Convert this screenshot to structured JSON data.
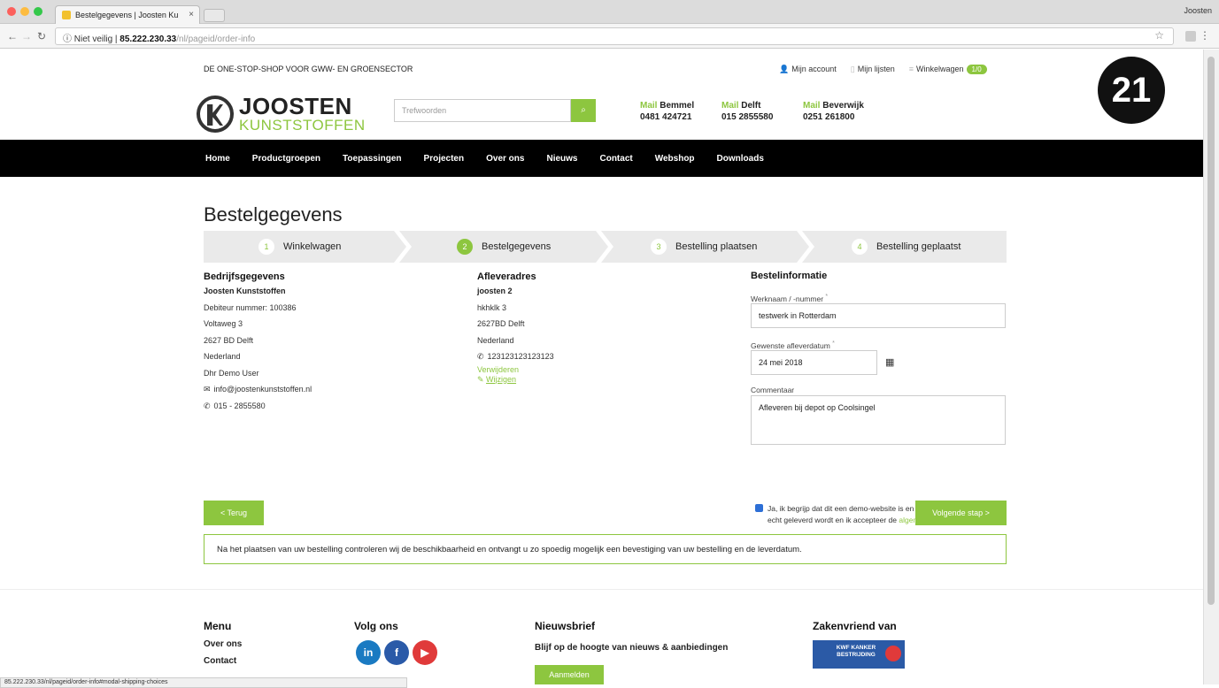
{
  "browser": {
    "tab_title": "Bestelgegevens | Joosten Ku",
    "tab_close": "×",
    "profile": "Joosten",
    "security": "Niet veilig",
    "host": "85.222.230.33",
    "path": "/nl/pageid/order-info",
    "status_url": "85.222.230.33/nl/pageid/order-info#modal-shipping-choices"
  },
  "header": {
    "tagline": "DE ONE-STOP-SHOP VOOR GWW- EN GROENSECTOR",
    "account": "Mijn account",
    "lists": "Mijn lijsten",
    "cart": "Winkelwagen",
    "cart_count": "1/0",
    "logo_main": "JOOSTEN",
    "logo_sub": "KUNSTSTOFFEN",
    "search_placeholder": "Trefwoorden",
    "contacts": [
      {
        "mail": "Mail",
        "city": "Bemmel",
        "phone": "0481 424721"
      },
      {
        "mail": "Mail",
        "city": "Delft",
        "phone": "015 2855580"
      },
      {
        "mail": "Mail",
        "city": "Beverwijk",
        "phone": "0251 261800"
      }
    ],
    "badge": "21"
  },
  "nav": [
    "Home",
    "Productgroepen",
    "Toepassingen",
    "Projecten",
    "Over ons",
    "Nieuws",
    "Contact",
    "Webshop",
    "Downloads"
  ],
  "page_title": "Bestelgegevens",
  "steps": [
    {
      "num": "1",
      "label": "Winkelwagen"
    },
    {
      "num": "2",
      "label": "Bestelgegevens"
    },
    {
      "num": "3",
      "label": "Bestelling plaatsen"
    },
    {
      "num": "4",
      "label": "Bestelling geplaatst"
    }
  ],
  "company": {
    "heading": "Bedrijfsgegevens",
    "name": "Joosten Kunststoffen",
    "debtor": "Debiteur nummer: 100386",
    "street": "Voltaweg 3",
    "zip_city": "2627 BD Delft",
    "country": "Nederland",
    "contact": "Dhr Demo User",
    "email": "info@joostenkunststoffen.nl",
    "phone": "015 - 2855580"
  },
  "delivery": {
    "heading": "Afleveradres",
    "name": "joosten 2",
    "street": "hkhklk 3",
    "zip_city": "2627BD Delft",
    "country": "Nederland",
    "phone": "123123123123123",
    "remove": "Verwijderen",
    "edit": "Wijzigen"
  },
  "order": {
    "heading": "Bestelinformatie",
    "project_label": "Werknaam / -nummer",
    "project_value": "testwerk in Rotterdam",
    "date_label": "Gewenste afleverdatum",
    "date_value": "24 mei 2018",
    "comment_label": "Commentaar",
    "comment_value": "Afleveren bij depot op Coolsingel",
    "required": "*",
    "consent_text": "Ja, ik begrijp dat dit een demo-website is en dat deze bestelling niet echt geleverd wordt en ik accepteer de",
    "consent_link": "algemene voorwaarden",
    "consent_end": "."
  },
  "buttons": {
    "back": "< Terug",
    "next": "Volgende stap >"
  },
  "notice": "Na het plaatsen van uw bestelling controleren wij de beschikbaarheid en ontvangt u zo spoedig mogelijk een bevestiging van uw bestelling en de leverdatum.",
  "footer": {
    "menu_heading": "Menu",
    "menu_items": [
      "Over ons",
      "Contact"
    ],
    "follow_heading": "Volg ons",
    "social": [
      "in",
      "f",
      "▶"
    ],
    "news_heading": "Nieuwsbrief",
    "news_text": "Blijf op de hoogte van nieuws & aanbiedingen",
    "news_button": "Aanmelden",
    "partner_heading": "Zakenvriend van",
    "partner_logo": "KWF KANKER BESTRIJDING"
  },
  "colors": {
    "accent": "#8dc63f",
    "nav_bg": "#000000"
  }
}
